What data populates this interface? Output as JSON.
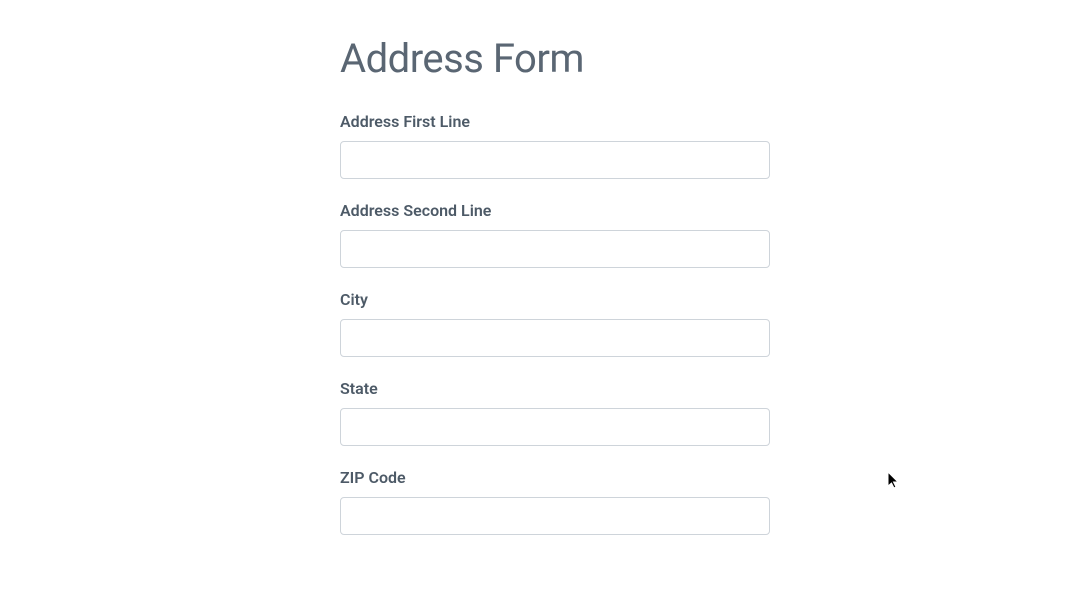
{
  "title": "Address Form",
  "fields": {
    "address1": {
      "label": "Address First Line",
      "value": ""
    },
    "address2": {
      "label": "Address Second Line",
      "value": ""
    },
    "city": {
      "label": "City",
      "value": ""
    },
    "state": {
      "label": "State",
      "value": ""
    },
    "zip": {
      "label": "ZIP Code",
      "value": ""
    }
  }
}
